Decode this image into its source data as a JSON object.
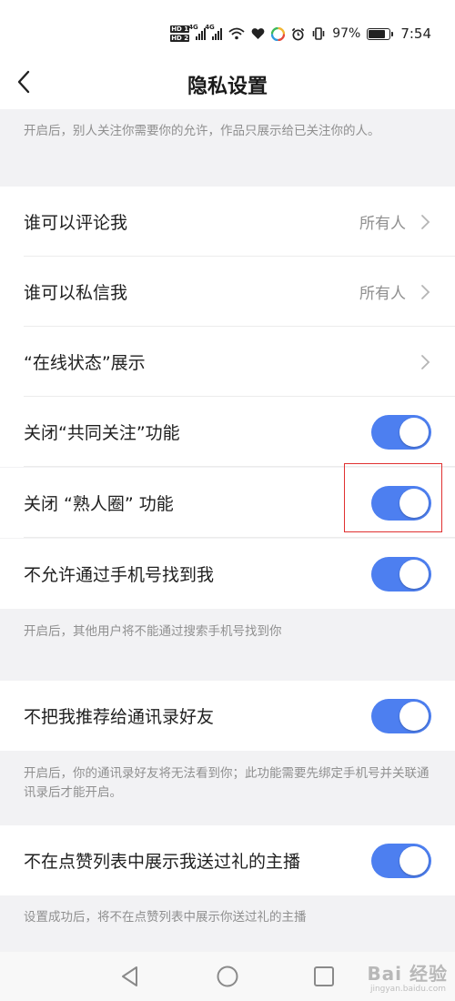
{
  "status_bar": {
    "hd_badges": [
      "HD 1",
      "HD 2"
    ],
    "network_labels": [
      "4G",
      "4G"
    ],
    "battery_percent": "97%",
    "battery_level": 0.97,
    "time": "7:54"
  },
  "header": {
    "title": "隐私设置",
    "back_icon": "chevron-left-icon"
  },
  "notes": {
    "top": "开启后，别人关注你需要你的允许，作品只展示给已关注你的人。",
    "phone": "开启后，其他用户将不能通过搜索手机号找到你",
    "contacts": "开启后，你的通讯录好友将无法看到你；此功能需要先绑定手机号并关联通讯录后才能开启。",
    "gift": "设置成功后，将不在点赞列表中展示你送过礼的主播"
  },
  "settings": {
    "comment": {
      "label": "谁可以评论我",
      "value": "所有人"
    },
    "message": {
      "label": "谁可以私信我",
      "value": "所有人"
    },
    "online_status": {
      "label": "“在线状态”展示"
    },
    "mutual_follow": {
      "label": "关闭“共同关注”功能",
      "on": true
    },
    "acquaintance": {
      "label": "关闭 “熟人圈” 功能",
      "on": true
    },
    "phone_search": {
      "label": "不允许通过手机号找到我",
      "on": true
    },
    "contacts_recommend": {
      "label": "不把我推荐给通讯录好友",
      "on": true
    },
    "gift_list": {
      "label": "不在点赞列表中展示我送过礼的主播",
      "on": true
    }
  },
  "colors": {
    "toggle_on": "#4d7ff0",
    "highlight_box": "#e03030",
    "background": "#f2f2f4"
  },
  "nav_bar": {
    "buttons": [
      "back-triangle-icon",
      "home-circle-icon",
      "recents-square-icon"
    ],
    "watermark": "Bai 经验",
    "watermark_sub": "jingyan.baidu.com"
  }
}
